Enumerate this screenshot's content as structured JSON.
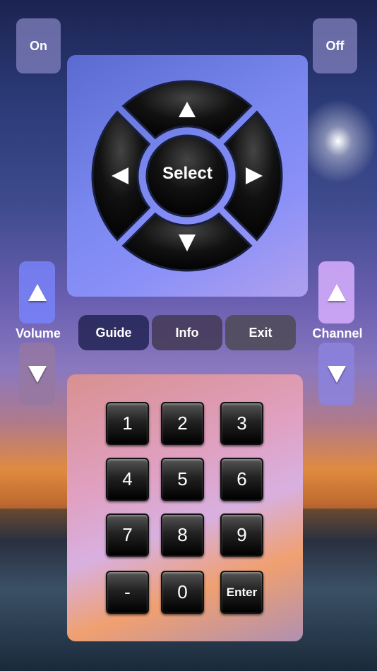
{
  "power": {
    "on_label": "On",
    "off_label": "Off"
  },
  "dpad": {
    "select_label": "Select",
    "up_icon": "arrow-up-icon",
    "down_icon": "arrow-down-icon",
    "left_icon": "arrow-left-icon",
    "right_icon": "arrow-right-icon"
  },
  "volume": {
    "label": "Volume"
  },
  "channel": {
    "label": "Channel"
  },
  "menu": {
    "guide": "Guide",
    "info": "Info",
    "exit": "Exit"
  },
  "keypad": {
    "keys": [
      "1",
      "2",
      "3",
      "4",
      "5",
      "6",
      "7",
      "8",
      "9",
      "-",
      "0",
      "Enter"
    ]
  }
}
